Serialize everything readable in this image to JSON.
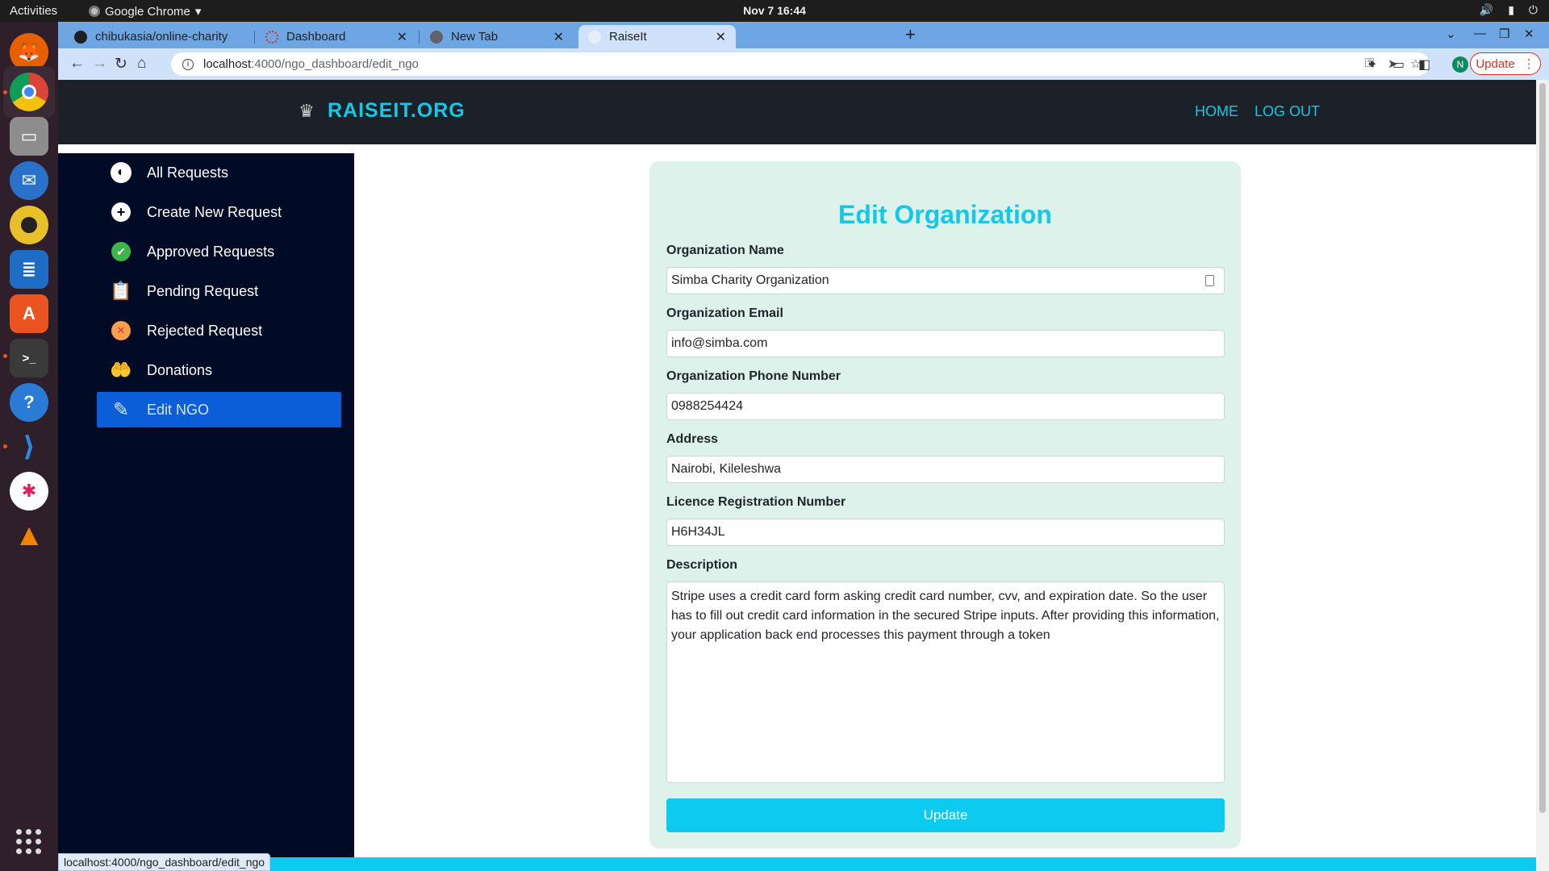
{
  "os": {
    "activities": "Activities",
    "app_name": "Google Chrome",
    "clock": "Nov 7  16:44"
  },
  "dock": {
    "apps": [
      "Firefox",
      "Google Chrome",
      "Files",
      "Thunderbird",
      "Rhythmbox",
      "LibreOffice Writer",
      "Ubuntu Software",
      "Terminal",
      "Help",
      "Visual Studio Code",
      "Slack",
      "VLC",
      "Show Applications"
    ]
  },
  "browser": {
    "tabs": [
      {
        "label": "chibukasia/online-charity",
        "active": false
      },
      {
        "label": "Dashboard",
        "active": false
      },
      {
        "label": "New Tab",
        "active": false
      },
      {
        "label": "RaiseIt",
        "active": true
      }
    ],
    "url_host": "localhost",
    "url_path": ":4000/ngo_dashboard/edit_ngo",
    "profile_initial": "N",
    "update_label": "Update",
    "status_url": "localhost:4000/ngo_dashboard/edit_ngo"
  },
  "site": {
    "brand": "RAISEIT.ORG",
    "nav": {
      "home": "HOME",
      "logout": "LOG OUT"
    },
    "accent_color": "#16c7e6"
  },
  "sidebar": {
    "items": [
      {
        "label": "All Requests",
        "icon": "globe-icon"
      },
      {
        "label": "Create New Request",
        "icon": "plus-circle-icon"
      },
      {
        "label": "Approved Requests",
        "icon": "check-badge-icon"
      },
      {
        "label": "Pending Request",
        "icon": "clipboard-clock-icon"
      },
      {
        "label": "Rejected Request",
        "icon": "x-circle-icon"
      },
      {
        "label": "Donations",
        "icon": "hands-icon"
      },
      {
        "label": "Edit NGO",
        "icon": "edit-icon",
        "active": true
      }
    ]
  },
  "form": {
    "title": "Edit Organization",
    "fields": {
      "name": {
        "label": "Organization Name",
        "value": "Simba Charity Organization"
      },
      "email": {
        "label": "Organization Email",
        "value": "info@simba.com"
      },
      "phone": {
        "label": "Organization Phone Number",
        "value": "0988254424"
      },
      "address": {
        "label": "Address",
        "value": "Nairobi, Kileleshwa"
      },
      "licence": {
        "label": "Licence Registration Number",
        "value": "H6H34JL"
      },
      "description": {
        "label": "Description",
        "value": "Stripe uses a credit card form asking credit card number, cvv, and expiration date. So the user has to fill out credit card information in the secured Stripe inputs. After providing this information, your application back end processes this payment through a token"
      }
    },
    "submit_label": "Update"
  }
}
